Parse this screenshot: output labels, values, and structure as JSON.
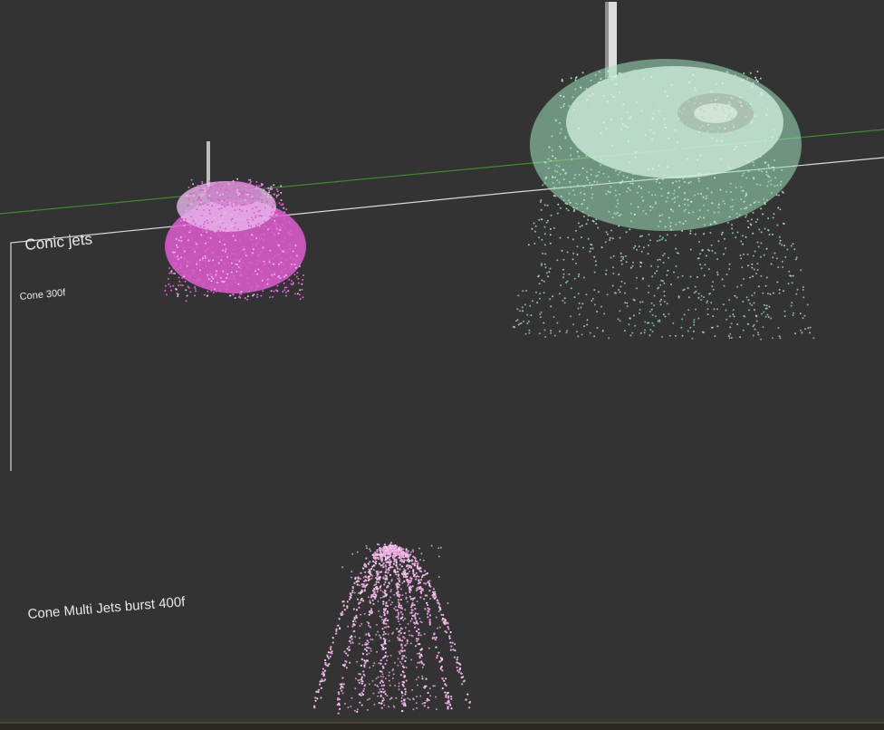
{
  "viewport": {
    "background": "#333333",
    "grid_line_color": "#3a7a2a",
    "outline_color": "#d8d8d8"
  },
  "labels": {
    "conic_jets": "Conic jets",
    "cone_300f": "Cone 300f",
    "cone_multi_jets": "Cone Multi Jets burst 400f"
  },
  "emitters": {
    "magenta_cone": {
      "color": "#e05ed0",
      "highlight": "#e8b6ec"
    },
    "mint_cone": {
      "color": "#9fe3bd",
      "highlight": "#d6f0e2"
    },
    "pink_burst": {
      "color": "#e9a6dc",
      "highlight": "#f3cfee"
    }
  }
}
